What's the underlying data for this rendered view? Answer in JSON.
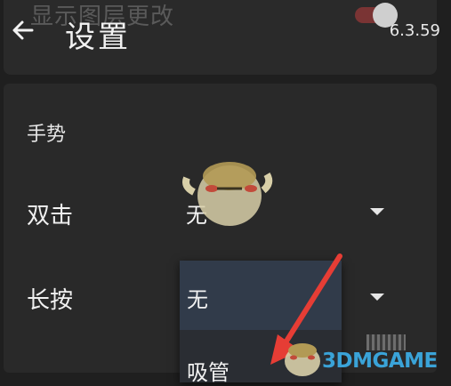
{
  "header": {
    "faded_title": "显示图层更改",
    "title": "设置",
    "version": "6.3.59",
    "back_icon": "arrow-left-icon",
    "toggle_state": "on",
    "toggle_accent": "#7a3434"
  },
  "settings": {
    "section_title": "手势",
    "double_tap": {
      "label": "双击",
      "value": "无"
    },
    "long_press": {
      "label": "长按",
      "value": "无"
    }
  },
  "dropdown": {
    "options": [
      "无",
      "吸管"
    ],
    "selected": "无"
  },
  "watermark": {
    "text": "3DMGAME"
  },
  "colors": {
    "background": "#1f1f1f",
    "card": "#292929",
    "dropdown_selected": "#313b4a",
    "arrow": "#e63d35"
  }
}
